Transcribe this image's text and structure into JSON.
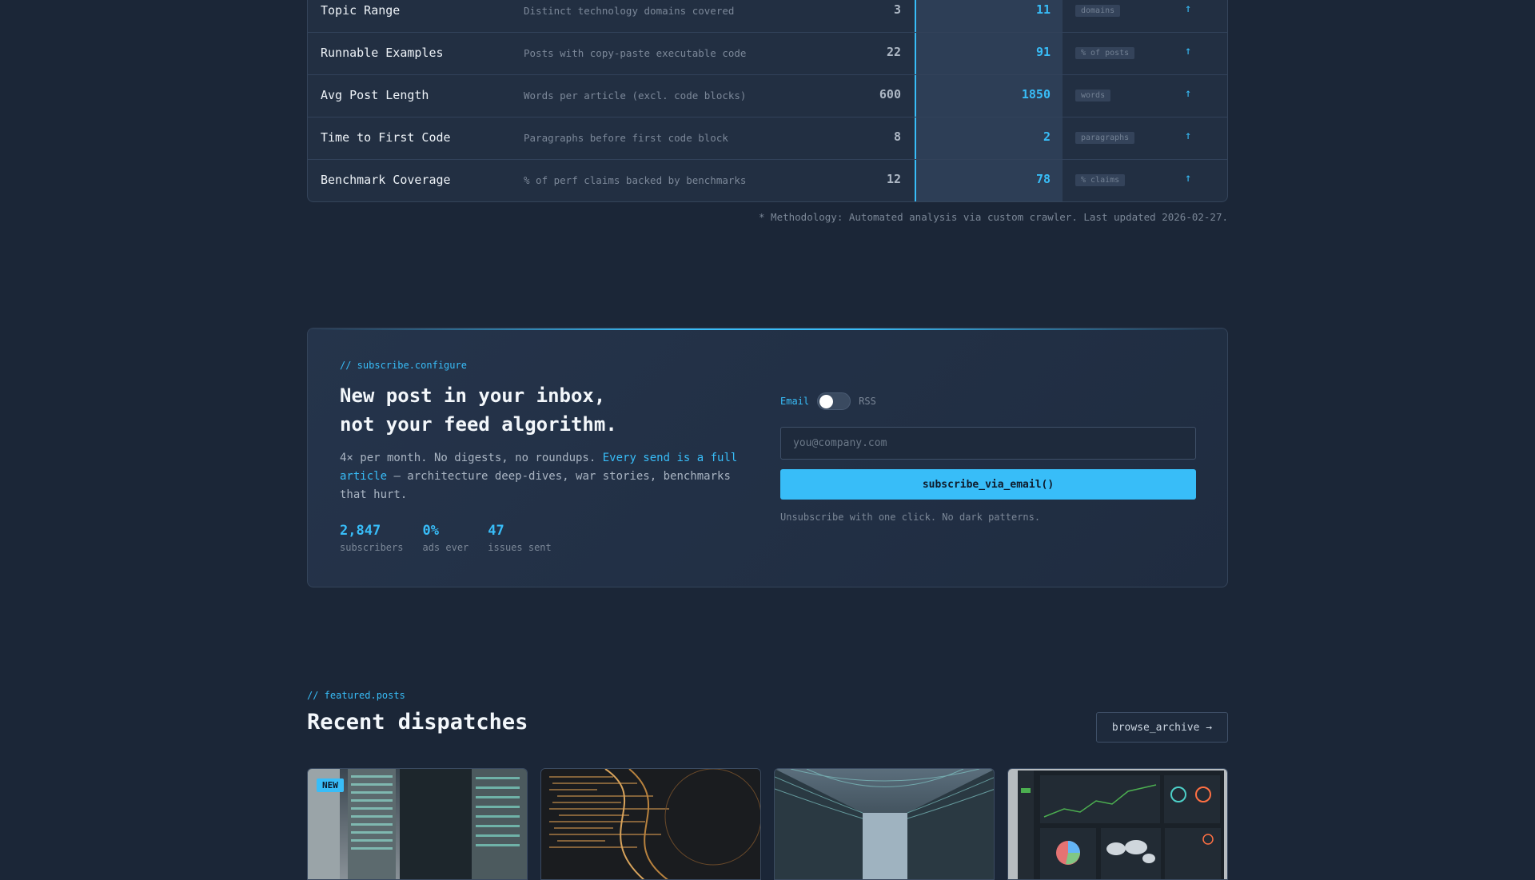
{
  "metrics": {
    "rows": [
      {
        "name": "Topic Range",
        "description": "Distinct technology domains covered",
        "before": "3",
        "after": "11",
        "unit": "domains",
        "arrow": "↑"
      },
      {
        "name": "Runnable Examples",
        "description": "Posts with copy-paste executable code",
        "before": "22",
        "after": "91",
        "unit": "% of posts",
        "arrow": "↑"
      },
      {
        "name": "Avg Post Length",
        "description": "Words per article (excl. code blocks)",
        "before": "600",
        "after": "1850",
        "unit": "words",
        "arrow": "↑"
      },
      {
        "name": "Time to First Code",
        "description": "Paragraphs before first code block",
        "before": "8",
        "after": "2",
        "unit": "paragraphs",
        "arrow": "↑"
      },
      {
        "name": "Benchmark Coverage",
        "description": "% of perf claims backed by benchmarks",
        "before": "12",
        "after": "78",
        "unit": "% claims",
        "arrow": "↑"
      }
    ],
    "footnote": "* Methodology: Automated analysis via custom crawler. Last updated 2026-02-27."
  },
  "subscribe": {
    "comment": "// subscribe.configure",
    "headline_line1": "New post in your inbox,",
    "headline_line2": "not your feed algorithm.",
    "body_prefix": "4× per month. No digests, no roundups. ",
    "body_highlight": "Every send is a full article",
    "body_suffix": " — architecture deep-dives, war stories, benchmarks that hurt.",
    "stats": [
      {
        "value": "2,847",
        "label": "subscribers"
      },
      {
        "value": "0%",
        "label": "ads ever"
      },
      {
        "value": "47",
        "label": "issues sent"
      }
    ],
    "toggle": {
      "left": "Email",
      "right": "RSS",
      "selected": "Email"
    },
    "email_placeholder": "you@company.com",
    "email_value": "",
    "button_label": "subscribe_via_email()",
    "note": "Unsubscribe with one click. No dark patterns."
  },
  "featured": {
    "comment": "// featured.posts",
    "title": "Recent dispatches",
    "browse_label": "browse_archive →",
    "cards": [
      {
        "badge": "NEW",
        "image": "server-rack-image"
      },
      {
        "badge": "",
        "image": "code-screen-image"
      },
      {
        "badge": "",
        "image": "datacenter-corridor-image"
      },
      {
        "badge": "",
        "image": "dashboard-screen-image"
      }
    ]
  },
  "colors": {
    "accent": "#38bdf8",
    "background": "#1b2637",
    "panel": "#222f42"
  }
}
